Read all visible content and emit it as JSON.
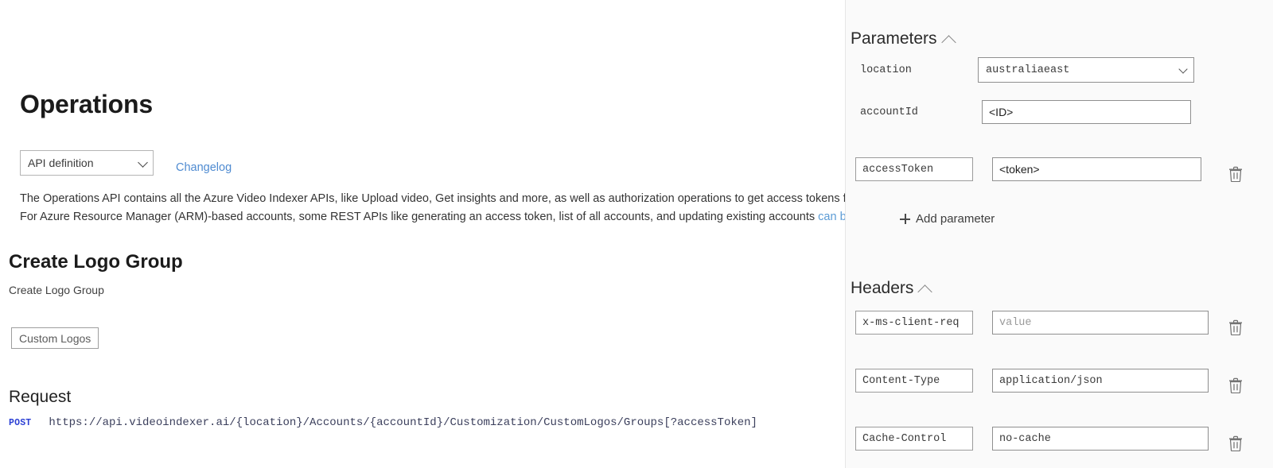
{
  "doc": {
    "page_title": "Operations",
    "api_definition_select": {
      "value": "API definition",
      "options": [
        "API definition"
      ]
    },
    "changelog_link": "Changelog",
    "description_line1": "The Operations API contains all the Azure Video Indexer APIs, like Upload video, Get insights and more, as well as authorization operations to get access tokens for ca",
    "description_line2_a": "For Azure Resource Manager (ARM)-based accounts, some REST APIs like generating an access token, list of all accounts, and updating existing accounts ",
    "description_line2_link": "can be foun",
    "operation_title": "Create Logo Group",
    "operation_description": "Create Logo Group",
    "tag_button": "Custom Logos",
    "request_heading": "Request",
    "request_method": "POST",
    "request_url": "https://api.videoindexer.ai/{location}/Accounts/{accountId}/Customization/CustomLogos/Groups[?accessToken]"
  },
  "panel": {
    "parameters": {
      "heading": "Parameters",
      "collapse_icon": "chevron-up-icon",
      "add_parameter_label": "Add parameter",
      "rows": [
        {
          "name": "location",
          "name_editable": false,
          "kind": "select",
          "value": "australiaeast",
          "options": [
            "australiaeast"
          ],
          "deletable": false
        },
        {
          "name": "accountId",
          "name_editable": false,
          "kind": "text",
          "value": "<ID>",
          "placeholder": "",
          "deletable": false
        },
        {
          "name": "accessToken",
          "name_editable": true,
          "kind": "text",
          "value": "<token>",
          "placeholder": "",
          "deletable": true
        }
      ]
    },
    "headers": {
      "heading": "Headers",
      "collapse_icon": "chevron-up-icon",
      "rows": [
        {
          "name": "x-ms-client-req",
          "kind": "text",
          "value": "",
          "placeholder": "value",
          "deletable": true
        },
        {
          "name": "Content-Type",
          "kind": "text",
          "value": "application/json",
          "placeholder": "",
          "deletable": true
        },
        {
          "name": "Cache-Control",
          "kind": "text",
          "value": "no-cache",
          "placeholder": "",
          "deletable": true
        }
      ]
    }
  },
  "colors": {
    "link": "#5b9bd5",
    "method": "#2b3fd4",
    "panel_bg": "#fafafa",
    "border": "#8f8f8f"
  }
}
